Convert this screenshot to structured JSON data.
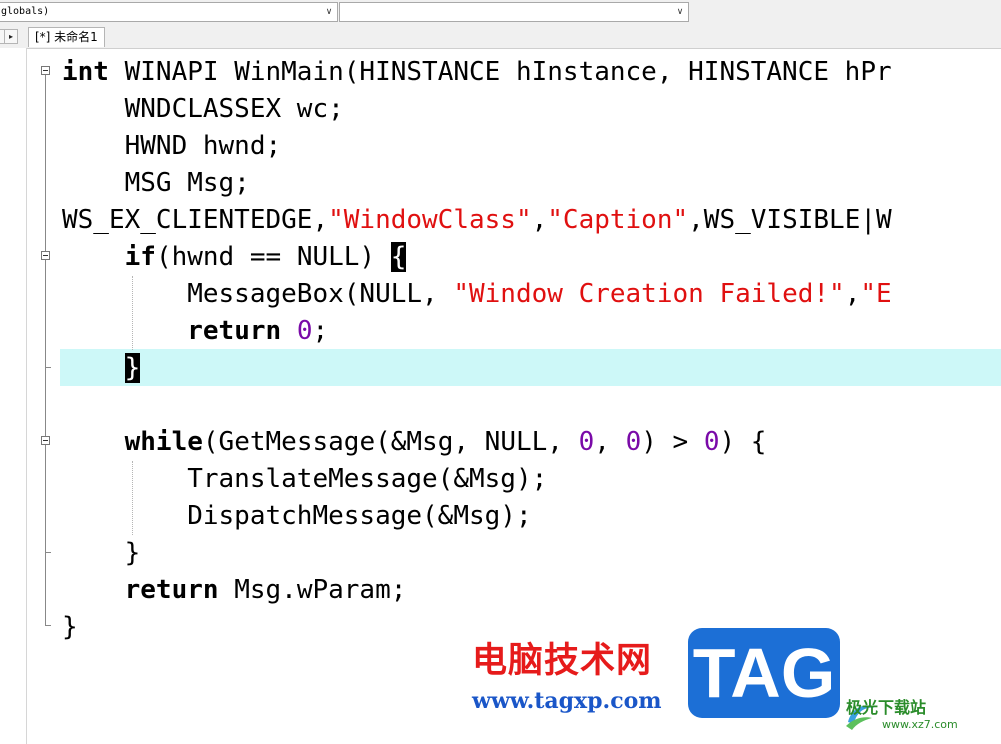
{
  "toolbar": {
    "scope_combo_value": "globals)",
    "member_combo_value": "",
    "combo_arrow": "∨"
  },
  "tabs": {
    "nav_right": "▸",
    "active_tab_label": "[*] 未命名1"
  },
  "code_lines": [
    [
      [
        "kw",
        "int"
      ],
      [
        "n",
        " WINAPI WinMain(HINSTANCE hInstance, HINSTANCE hPr"
      ]
    ],
    [
      [
        "n",
        "    WNDCLASSEX wc;"
      ]
    ],
    [
      [
        "n",
        "    HWND hwnd;"
      ]
    ],
    [
      [
        "n",
        "    MSG Msg;"
      ]
    ],
    [
      [
        "n",
        "WS_EX_CLIENTEDGE,"
      ],
      [
        "str",
        "\"WindowClass\""
      ],
      [
        "n",
        ","
      ],
      [
        "str",
        "\"Caption\""
      ],
      [
        "n",
        ",WS_VISIBLE|W"
      ]
    ],
    [
      [
        "n",
        "    "
      ],
      [
        "kw",
        "if"
      ],
      [
        "n",
        "(hwnd == NULL) "
      ],
      [
        "hl",
        "{"
      ]
    ],
    [
      [
        "n",
        "        MessageBox(NULL, "
      ],
      [
        "str",
        "\"Window Creation Failed!\""
      ],
      [
        "n",
        ","
      ],
      [
        "str",
        "\"E"
      ]
    ],
    [
      [
        "n",
        "        "
      ],
      [
        "kw",
        "return"
      ],
      [
        "n",
        " "
      ],
      [
        "num",
        "0"
      ],
      [
        "n",
        ";"
      ]
    ],
    [
      [
        "n",
        "    "
      ],
      [
        "hl",
        "}"
      ]
    ],
    [
      [
        "n",
        ""
      ]
    ],
    [
      [
        "n",
        "    "
      ],
      [
        "kw",
        "while"
      ],
      [
        "n",
        "(GetMessage(&Msg, NULL, "
      ],
      [
        "num",
        "0"
      ],
      [
        "n",
        ", "
      ],
      [
        "num",
        "0"
      ],
      [
        "n",
        ") > "
      ],
      [
        "num",
        "0"
      ],
      [
        "n",
        ") {"
      ]
    ],
    [
      [
        "n",
        "        TranslateMessage(&Msg);"
      ]
    ],
    [
      [
        "n",
        "        DispatchMessage(&Msg);"
      ]
    ],
    [
      [
        "n",
        "    }"
      ]
    ],
    [
      [
        "n",
        "    "
      ],
      [
        "kw",
        "return"
      ],
      [
        "n",
        " Msg.wParam;"
      ]
    ],
    [
      [
        "n",
        "}"
      ]
    ]
  ],
  "watermark": {
    "cn_text": "电脑技术网",
    "url_text": "www.tagxp.com",
    "tag_text": "TAG",
    "site_name": "极光下载站",
    "site_url": "www.xz7.com"
  },
  "colors": {
    "keyword": "#000000",
    "string": "#e01010",
    "number": "#7a0aa8",
    "current_line": "#cdf8f8"
  }
}
